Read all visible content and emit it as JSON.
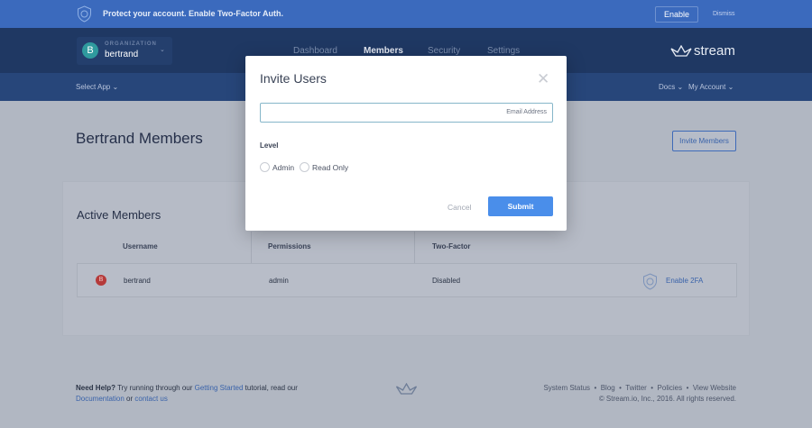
{
  "banner": {
    "message": "Protect your account. Enable Two-Factor Auth.",
    "enable": "Enable",
    "dismiss": "Dismiss"
  },
  "org": {
    "label": "ORGANIZATION",
    "name": "bertrand",
    "initial": "B"
  },
  "nav": {
    "tabs": [
      "Dashboard",
      "Members",
      "Security",
      "Settings"
    ],
    "active": "Members",
    "logo": "stream"
  },
  "subnav": {
    "select_app": "Select App",
    "docs": "Docs",
    "account": "My Account"
  },
  "page": {
    "title": "Bertrand Members",
    "invite": "Invite Members"
  },
  "members": {
    "heading": "Active Members",
    "columns": [
      "Username",
      "Permissions",
      "Two-Factor"
    ],
    "rows": [
      {
        "initial": "B",
        "username": "bertrand",
        "permissions": "admin",
        "two_factor": "Disabled",
        "action": "Enable 2FA"
      }
    ]
  },
  "footer": {
    "need_help": "Need Help?",
    "t1": " Try running through our ",
    "getting_started": "Getting Started",
    "t2": " tutorial, read our",
    "documentation": "Documentation",
    "t3": " or ",
    "contact": "contact us",
    "links": [
      "System Status",
      "Blog",
      "Twitter",
      "Policies",
      "View Website"
    ],
    "copyright": "© Stream.io, Inc., 2016. All rights reserved."
  },
  "modal": {
    "title": "Invite Users",
    "email_placeholder": "Email Address",
    "level": "Level",
    "options": [
      "Admin",
      "Read Only"
    ],
    "cancel": "Cancel",
    "submit": "Submit"
  }
}
